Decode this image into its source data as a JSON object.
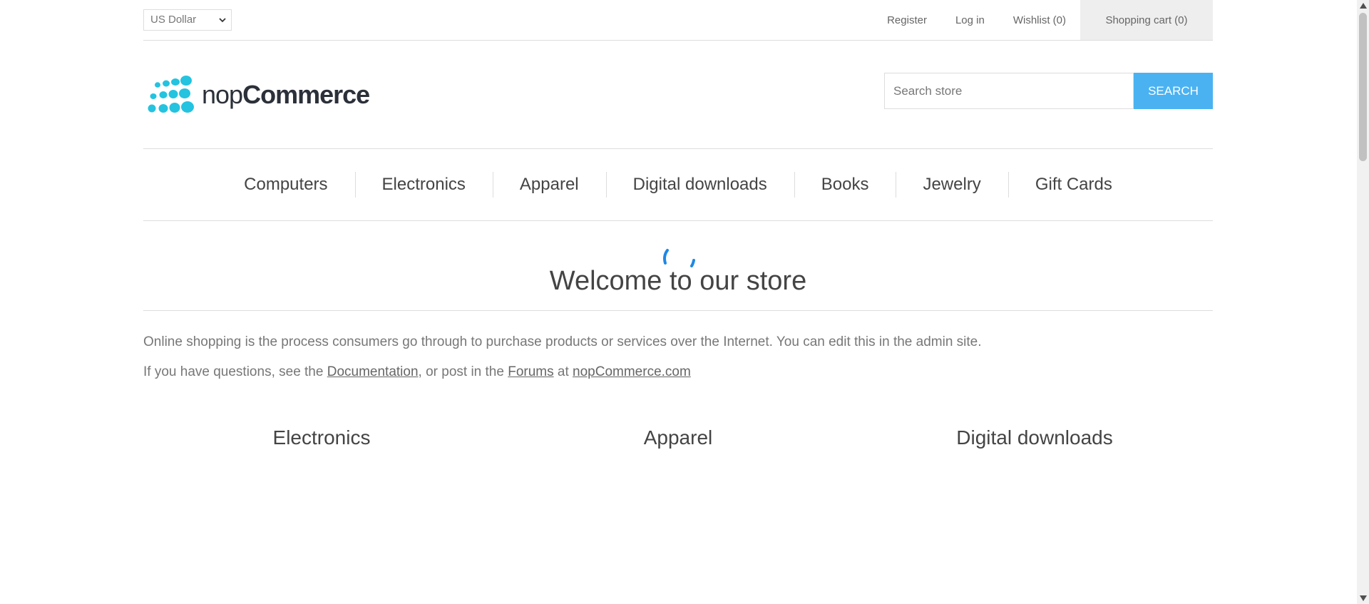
{
  "header": {
    "currency": {
      "selected": "US Dollar"
    },
    "links": {
      "register": "Register",
      "login": "Log in",
      "wishlist": "Wishlist (0)",
      "cart": "Shopping cart (0)"
    }
  },
  "logo": {
    "text_light": "nop",
    "text_bold": "Commerce",
    "color": "#24c3e0"
  },
  "search": {
    "placeholder": "Search store",
    "button_label": "Search",
    "button_color": "#4ab2f1"
  },
  "menu": {
    "items": [
      "Computers",
      "Electronics",
      "Apparel",
      "Digital downloads",
      "Books",
      "Jewelry",
      "Gift Cards"
    ]
  },
  "welcome": {
    "title": "Welcome to our store",
    "paragraph1": "Online shopping is the process consumers go through to purchase products or services over the Internet. You can edit this in the admin site.",
    "p2_prefix": "If you have questions, see the ",
    "p2_link_docs": "Documentation",
    "p2_middle": ", or post in the ",
    "p2_link_forums": "Forums",
    "p2_at": " at ",
    "p2_link_site": "nopCommerce.com"
  },
  "featured_categories": {
    "items": [
      "Electronics",
      "Apparel",
      "Digital downloads"
    ]
  },
  "spinner_color": "#1e88e5"
}
